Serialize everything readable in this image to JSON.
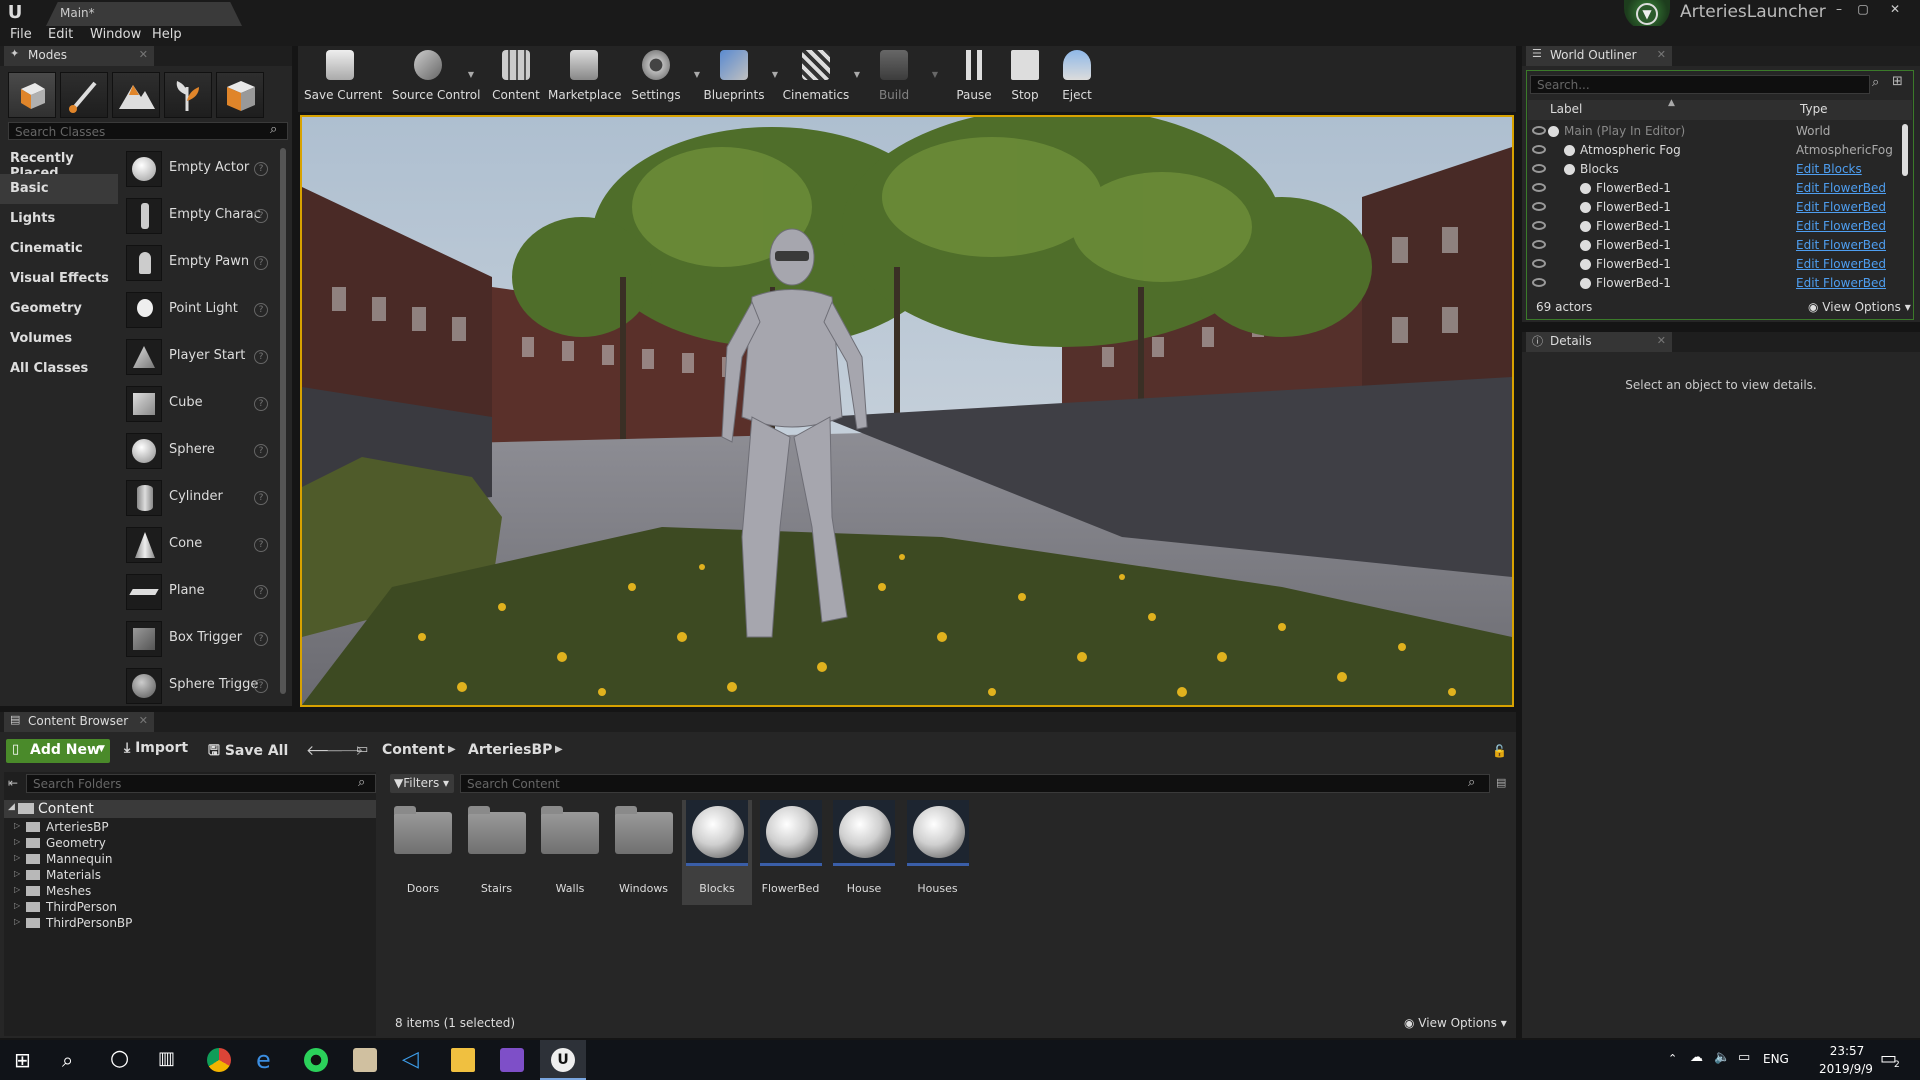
{
  "window": {
    "logo": "U",
    "doc_tab": "Main*",
    "launcher_name": "ArteriesLauncher",
    "controls": [
      "–",
      "▢",
      "✕"
    ]
  },
  "menu": [
    "File",
    "Edit",
    "Window",
    "Help"
  ],
  "modes": {
    "tab_label": "Modes",
    "search_placeholder": "Search Classes",
    "categories": [
      "Recently Placed",
      "Basic",
      "Lights",
      "Cinematic",
      "Visual Effects",
      "Geometry",
      "Volumes",
      "All Classes"
    ],
    "selected_category": "Basic",
    "placeables": [
      "Empty Actor",
      "Empty Charac",
      "Empty Pawn",
      "Point Light",
      "Player Start",
      "Cube",
      "Sphere",
      "Cylinder",
      "Cone",
      "Plane",
      "Box Trigger",
      "Sphere Trigge"
    ]
  },
  "toolbar": {
    "buttons": [
      "Save Current",
      "Source Control",
      "Content",
      "Marketplace",
      "Settings",
      "Blueprints",
      "Cinematics",
      "Build",
      "Pause",
      "Stop",
      "Eject"
    ]
  },
  "outliner": {
    "tab_label": "World Outliner",
    "search_placeholder": "Search...",
    "col_label": "Label",
    "col_type": "Type",
    "rows": [
      {
        "label": "Main (Play In Editor)",
        "type": "World",
        "link": false
      },
      {
        "label": "Atmospheric Fog",
        "type": "AtmosphericFog",
        "link": false
      },
      {
        "label": "Blocks",
        "type": "Edit Blocks",
        "link": true
      },
      {
        "label": "FlowerBed-1",
        "type": "Edit FlowerBed",
        "link": true
      },
      {
        "label": "FlowerBed-1",
        "type": "Edit FlowerBed",
        "link": true
      },
      {
        "label": "FlowerBed-1",
        "type": "Edit FlowerBed",
        "link": true
      },
      {
        "label": "FlowerBed-1",
        "type": "Edit FlowerBed",
        "link": true
      },
      {
        "label": "FlowerBed-1",
        "type": "Edit FlowerBed",
        "link": true
      },
      {
        "label": "FlowerBed-1",
        "type": "Edit FlowerBed",
        "link": true
      }
    ],
    "actor_count": "69 actors",
    "view_options": "View Options"
  },
  "details": {
    "tab_label": "Details",
    "empty_message": "Select an object to view details."
  },
  "content_browser": {
    "tab_label": "Content Browser",
    "add_new": "Add New",
    "import": "Import",
    "save_all": "Save All",
    "path": [
      "Content",
      "ArteriesBP"
    ],
    "folder_search_placeholder": "Search Folders",
    "filters": "Filters",
    "content_search_placeholder": "Search Content",
    "tree_root": "Content",
    "tree": [
      "ArteriesBP",
      "Geometry",
      "Mannequin",
      "Materials",
      "Meshes",
      "ThirdPerson",
      "ThirdPersonBP"
    ],
    "assets": [
      {
        "name": "Doors",
        "kind": "folder"
      },
      {
        "name": "Stairs",
        "kind": "folder"
      },
      {
        "name": "Walls",
        "kind": "folder"
      },
      {
        "name": "Windows",
        "kind": "folder"
      },
      {
        "name": "Blocks",
        "kind": "sphere"
      },
      {
        "name": "FlowerBed",
        "kind": "sphere"
      },
      {
        "name": "House",
        "kind": "sphere"
      },
      {
        "name": "Houses",
        "kind": "sphere"
      }
    ],
    "selected_asset": "Blocks",
    "status": "8 items (1 selected)",
    "view_options": "View Options"
  },
  "taskbar": {
    "lang": "ENG",
    "time": "23:57",
    "date": "2019/9/9",
    "notification_count": "2"
  },
  "colors": {
    "accent_orange": "#d8a200",
    "add_new_green": "#4a8a2a",
    "link_blue": "#4e9ef0",
    "outliner_border": "#3b7a2a"
  }
}
